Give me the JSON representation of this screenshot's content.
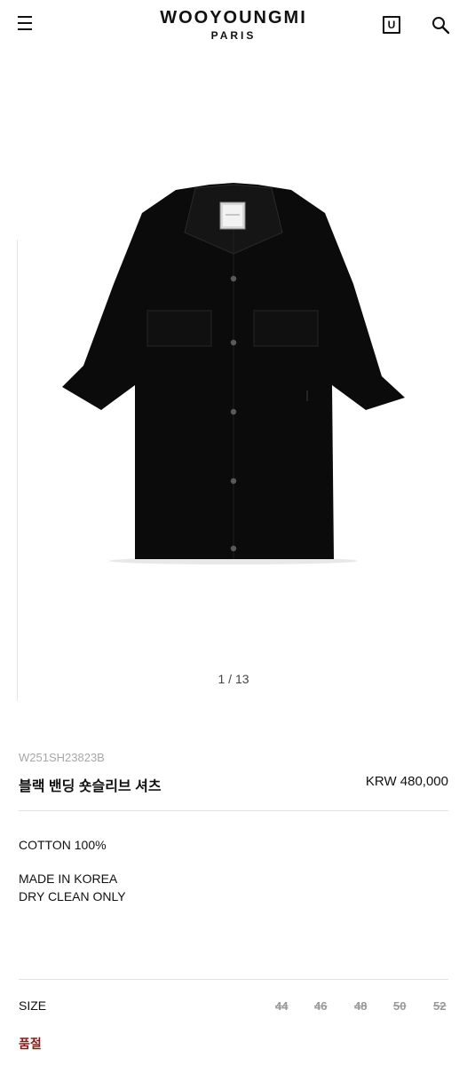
{
  "header": {
    "logo_main": "WOOYOUNGMI",
    "logo_sub": "PARIS",
    "bag_icon_letter": "U",
    "icons": [
      "hamburger-menu-icon",
      "shopping-bag-icon",
      "search-icon"
    ]
  },
  "gallery": {
    "pager": "1 / 13",
    "image_icon": "black-short-sleeve-shirt"
  },
  "product": {
    "sku": "W251SH23823B",
    "name": "블랙 밴딩 숏슬리브 셔츠",
    "price": "KRW 480,000"
  },
  "details": {
    "composition": "COTTON 100%",
    "origin": "MADE IN KOREA",
    "care": "DRY CLEAN ONLY"
  },
  "size": {
    "label": "SIZE",
    "options": [
      "44",
      "46",
      "48",
      "50",
      "52"
    ],
    "sold_out_label": "품절"
  },
  "colors": {
    "sold_out": "#8a1a1a",
    "muted": "#a8a8a8"
  }
}
